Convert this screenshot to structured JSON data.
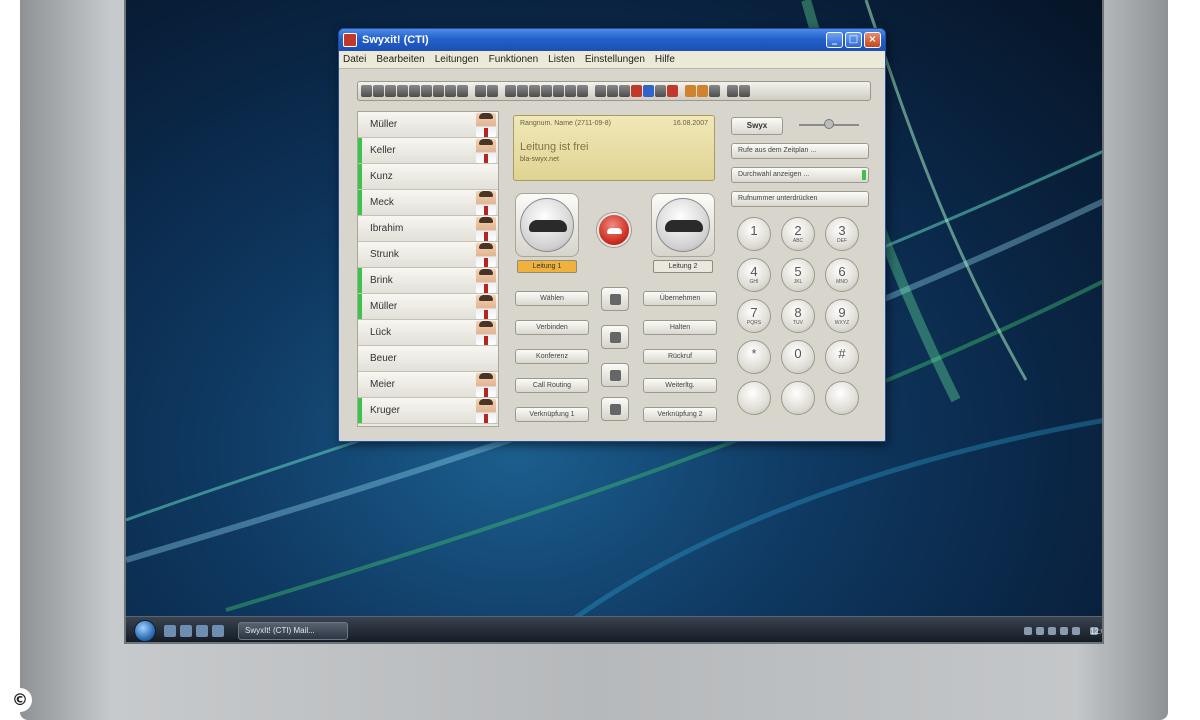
{
  "window": {
    "title": "Swyxit! (CTI)",
    "controls": [
      "minimize-icon",
      "maximize-icon",
      "close-icon"
    ]
  },
  "menu": [
    "Datei",
    "Bearbeiten",
    "Leitungen",
    "Funktionen",
    "Listen",
    "Einstellungen",
    "Hilfe"
  ],
  "contacts": [
    {
      "name": "Müller",
      "status": "none"
    },
    {
      "name": "Keller",
      "status": "online"
    },
    {
      "name": "Kunz",
      "status": "online"
    },
    {
      "name": "Meck",
      "status": "online"
    },
    {
      "name": "Ibrahim",
      "status": "none"
    },
    {
      "name": "Strunk",
      "status": "none"
    },
    {
      "name": "Brink",
      "status": "online"
    },
    {
      "name": "Müller",
      "status": "online"
    },
    {
      "name": "Lück",
      "status": "none"
    },
    {
      "name": "Beuer",
      "status": "none"
    },
    {
      "name": "Meier",
      "status": "none"
    },
    {
      "name": "Kruger",
      "status": "online"
    }
  ],
  "display": {
    "header_left": "Rangnum. Name (2711-09-8)",
    "header_right": "16.08.2007",
    "main": "Leitung ist frei",
    "sub": "bla-swyx.net"
  },
  "lines": [
    {
      "label": "Leitung 1",
      "active": true
    },
    {
      "label": "Leitung 2",
      "active": false
    }
  ],
  "function_buttons_left": [
    "Wählen",
    "Verbinden",
    "Konferenz",
    "Call Routing",
    "Verknüpfung 1"
  ],
  "function_buttons_right": [
    "Übernehmen",
    "Halten",
    "Rückruf",
    "Weiterltg.",
    "Verknüpfung 2"
  ],
  "center_icons": [
    "phonebook-icon",
    "voicemail-icon",
    "speaker-icon",
    "headset-icon"
  ],
  "right_panel": {
    "mini_button": "Swyx",
    "side_buttons": [
      {
        "label": "Rufe aus dem Zeitplan ...",
        "led": false
      },
      {
        "label": "Durchwahl anzeigen ...",
        "led": true
      },
      {
        "label": "Rufnummer unterdrücken",
        "led": false
      }
    ],
    "volume_level": 0.5
  },
  "keypad": [
    {
      "d": "1",
      "l": ""
    },
    {
      "d": "2",
      "l": "ABC"
    },
    {
      "d": "3",
      "l": "DEF"
    },
    {
      "d": "4",
      "l": "GHI"
    },
    {
      "d": "5",
      "l": "JKL"
    },
    {
      "d": "6",
      "l": "MNO"
    },
    {
      "d": "7",
      "l": "PQRS"
    },
    {
      "d": "8",
      "l": "TUV"
    },
    {
      "d": "9",
      "l": "WXYZ"
    },
    {
      "d": "*",
      "l": ""
    },
    {
      "d": "0",
      "l": ""
    },
    {
      "d": "#",
      "l": ""
    },
    {
      "d": "",
      "l": "",
      "icon": "redial-icon"
    },
    {
      "d": "",
      "l": "",
      "icon": "keypad-icon"
    },
    {
      "d": "",
      "l": "",
      "icon": "delete-icon"
    }
  ],
  "taskbar": {
    "task": "SwyxIt! (CTI) Mail...",
    "clock": "12:00"
  },
  "copyright": "©"
}
